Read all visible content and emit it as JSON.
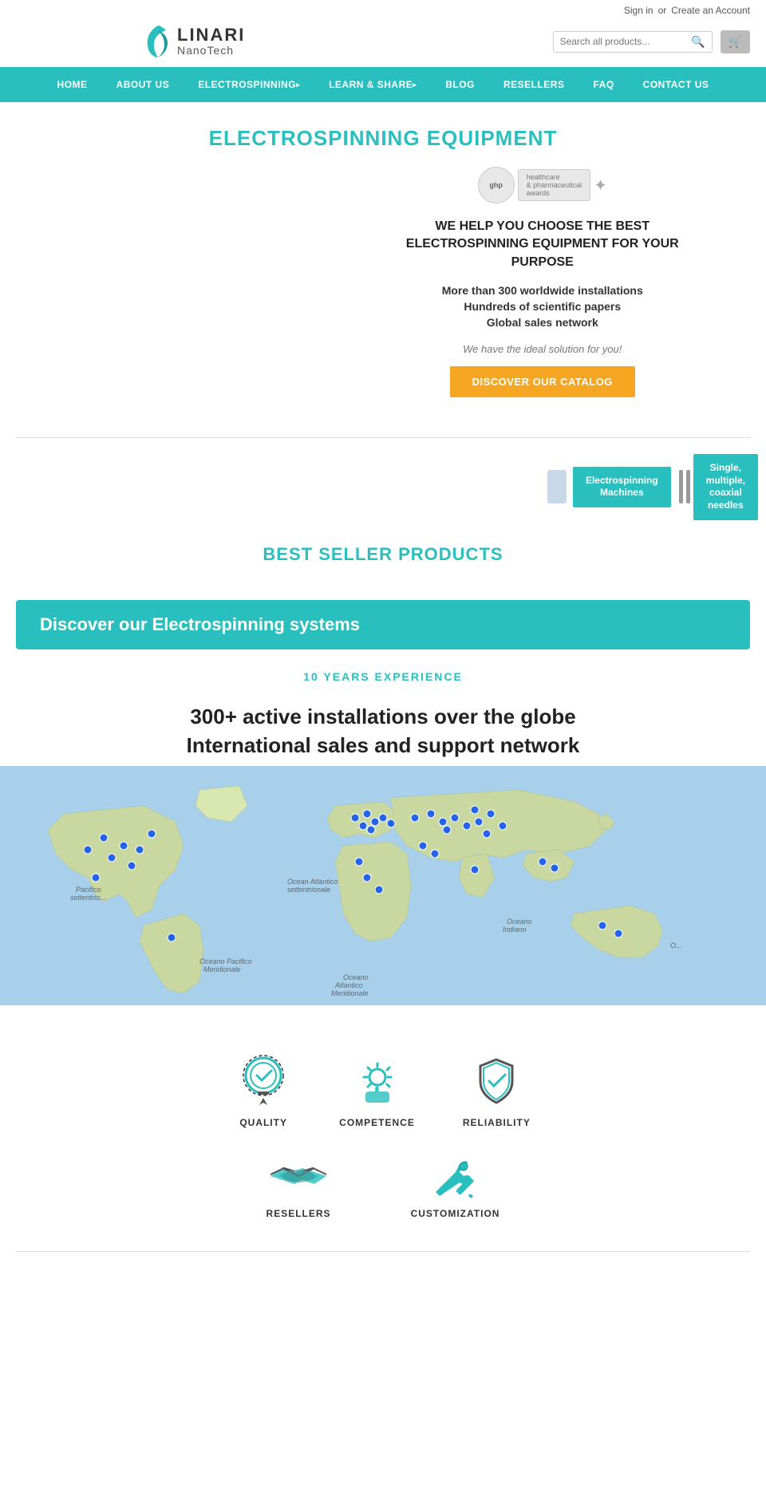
{
  "header": {
    "sign_in": "Sign in",
    "or": "or",
    "create_account": "Create an Account",
    "search_placeholder": "Search all products...",
    "logo_brand": "LINARI",
    "logo_sub": "NanoTech"
  },
  "nav": {
    "items": [
      {
        "label": "HOME",
        "has_dropdown": false
      },
      {
        "label": "ABOUT US",
        "has_dropdown": false
      },
      {
        "label": "ELECTROSPINNING",
        "has_dropdown": true
      },
      {
        "label": "LEARN & SHARE",
        "has_dropdown": true
      },
      {
        "label": "BLOG",
        "has_dropdown": false
      },
      {
        "label": "RESELLERS",
        "has_dropdown": false
      },
      {
        "label": "FAQ",
        "has_dropdown": false
      },
      {
        "label": "CONTACT US",
        "has_dropdown": false
      }
    ]
  },
  "equipment": {
    "section_title": "ELECTROSPINNING EQUIPMENT",
    "ghp_label": "ghp",
    "ghp_sub": "healthcare & pharmaceutical awards",
    "headline": "WE HELP YOU CHOOSE THE BEST ELECTROSPINNING EQUIPMENT FOR YOUR PURPOSE",
    "bullets": [
      "More than 300 worldwide installations",
      "Hundreds of scientific papers",
      "Global sales network"
    ],
    "tagline": "We have the ideal solution for you!",
    "catalog_btn": "DISCOVER OUR CATALOG"
  },
  "product_tabs": [
    {
      "label": "Electrospinning\nMachines"
    },
    {
      "label": "Single,\nmultiple,\ncoaxial\nneedles"
    }
  ],
  "best_seller": {
    "title": "BEST SELLER PRODUCTS",
    "discover_banner": "Discover our Electrospinning systems"
  },
  "experience": {
    "years_label": "10 YEARS EXPERIENCE",
    "installations": "300+ active installations over the globe",
    "support": "International sales and support network"
  },
  "quality": {
    "items": [
      {
        "label": "QUALITY"
      },
      {
        "label": "COMPETENCE"
      },
      {
        "label": "RELIABILITY"
      }
    ],
    "resellers": [
      {
        "label": "RESELLERS"
      },
      {
        "label": "CUSTOMIZATION"
      }
    ]
  },
  "colors": {
    "teal": "#2abfbf",
    "orange": "#f5a623",
    "nav_bg": "#2abfbf"
  }
}
